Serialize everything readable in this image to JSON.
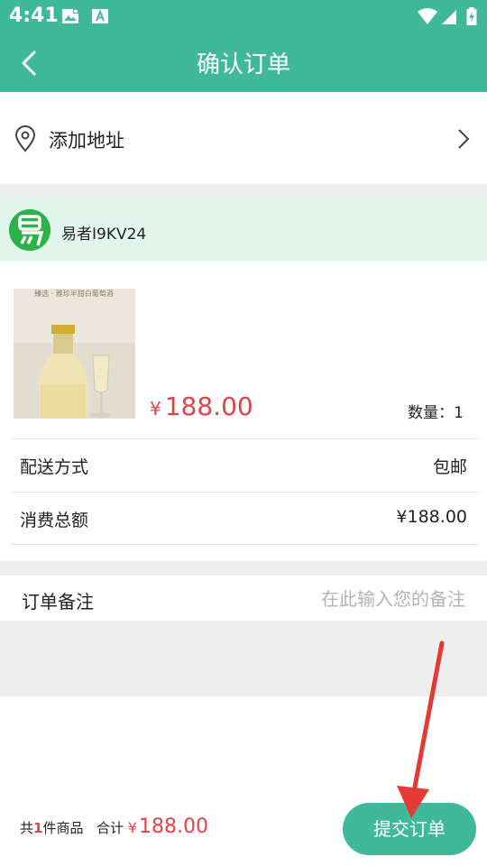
{
  "status_bar": {
    "time": "4:41"
  },
  "header": {
    "title": "确认订单"
  },
  "address": {
    "label": "添加地址"
  },
  "shop": {
    "name": "易者I9KV24"
  },
  "product": {
    "image_caption": "臻选 · 雅珍半甜白葡萄酒",
    "currency": "¥",
    "price": "188.00",
    "quantity_label": "数量：1"
  },
  "delivery": {
    "label": "配送方式",
    "value": "包邮"
  },
  "total_fee": {
    "label": "消费总额",
    "value": "¥188.00"
  },
  "remark": {
    "label": "订单备注",
    "placeholder": "在此输入您的备注"
  },
  "footer": {
    "count_prefix": "共",
    "count": "1",
    "count_suffix": "件商品",
    "total_label": "合计",
    "currency": "¥",
    "total": "188.00",
    "submit_label": "提交订单"
  },
  "colors": {
    "accent": "#3fb99a",
    "price": "#e2434a",
    "shop_bg": "#e3f6ee",
    "annotation_arrow": "#e53935"
  }
}
